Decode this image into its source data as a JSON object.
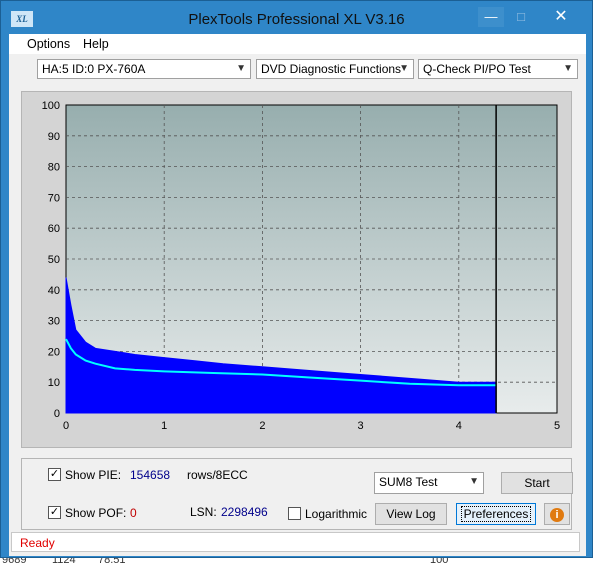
{
  "window": {
    "title": "PlexTools Professional XL V3.16",
    "app_icon_text": "XL"
  },
  "menu": {
    "items": [
      "Options",
      "Help"
    ]
  },
  "selectors": {
    "drive": "HA:5 ID:0  PX-760A",
    "function": "DVD Diagnostic Functions",
    "test": "Q-Check PI/PO Test"
  },
  "chart_data": {
    "type": "area",
    "x_ticks": [
      "0",
      "1",
      "2",
      "3",
      "4",
      "5"
    ],
    "y_ticks": [
      "0",
      "10",
      "20",
      "30",
      "40",
      "50",
      "60",
      "70",
      "80",
      "90",
      "100"
    ],
    "xlim": [
      0,
      5
    ],
    "ylim": [
      0,
      100
    ],
    "grid": true,
    "end_marker_x": 4.38,
    "series": [
      {
        "color": "#0000ff",
        "x": [
          0.0,
          0.05,
          0.1,
          0.2,
          0.3,
          0.5,
          0.7,
          1.0,
          1.3,
          1.6,
          2.0,
          2.4,
          2.8,
          3.2,
          3.6,
          4.0,
          4.38
        ],
        "y": [
          44,
          35,
          27,
          23,
          21,
          20,
          19,
          18,
          17,
          16,
          15,
          14,
          13,
          12,
          11,
          10,
          10
        ]
      },
      {
        "color": "#00ffff",
        "x": [
          0.0,
          0.05,
          0.1,
          0.2,
          0.3,
          0.5,
          0.7,
          1.0,
          1.5,
          2.0,
          2.5,
          3.0,
          3.5,
          4.0,
          4.38
        ],
        "y": [
          24,
          21,
          19,
          17,
          16,
          14.5,
          14,
          13.5,
          13,
          12.5,
          11.5,
          10.5,
          9.5,
          9,
          9
        ]
      }
    ]
  },
  "controls": {
    "show_pie_label": "Show PIE:",
    "pie_value": "154658",
    "pie_unit": "rows/8ECC",
    "show_pof_label": "Show POF:",
    "pof_value": "0",
    "lsn_label": "LSN:",
    "lsn_value": "2298496",
    "log_label": "Logarithmic",
    "sum_select": "SUM8 Test",
    "start_label": "Start",
    "viewlog_label": "View Log",
    "prefs_label": "Preferences",
    "info_icon": "i"
  },
  "status": {
    "text": "Ready"
  },
  "behind_window": [
    "9689",
    "1124",
    "78.51",
    "100"
  ]
}
